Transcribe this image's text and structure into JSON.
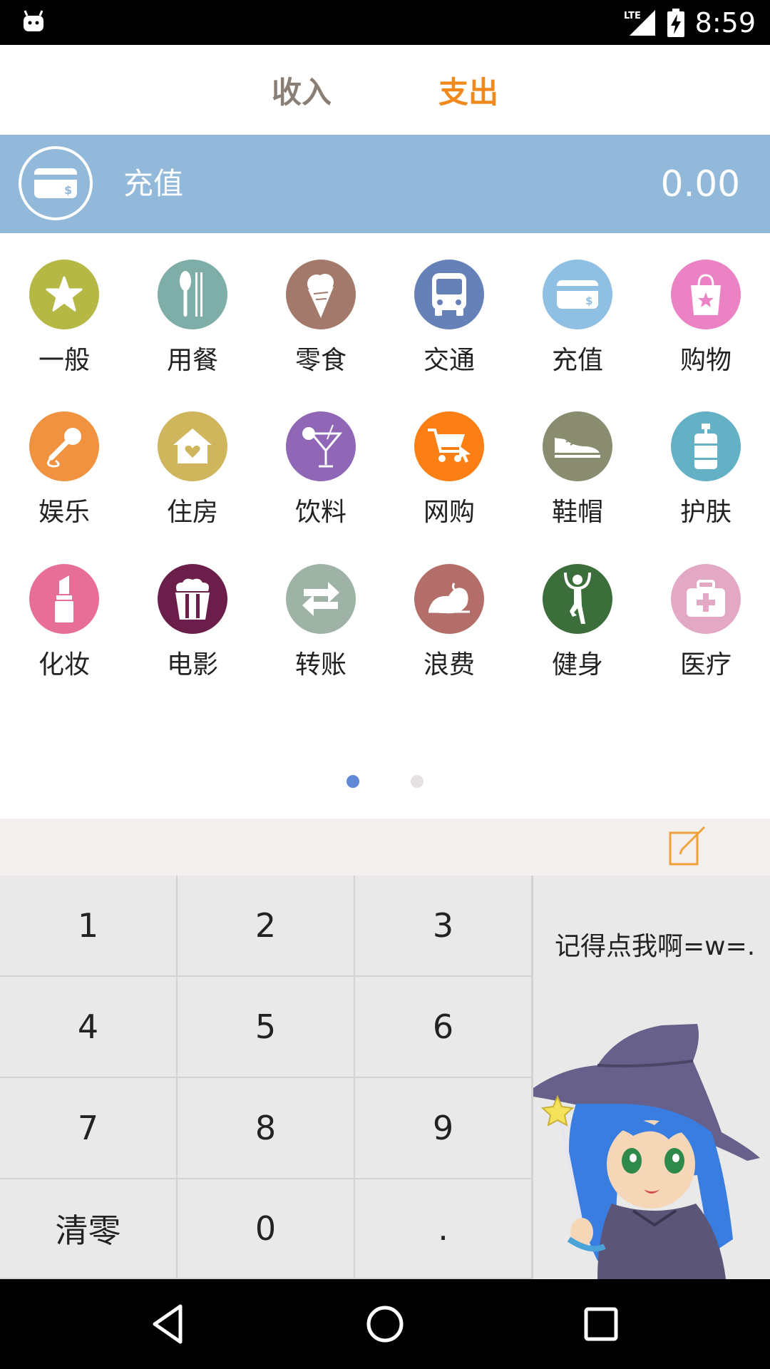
{
  "status_bar": {
    "network": "LTE",
    "time": "8:59"
  },
  "tabs": [
    {
      "label": "收入",
      "active": false
    },
    {
      "label": "支出",
      "active": true
    }
  ],
  "selected_category": {
    "label": "充值",
    "amount": "0.00",
    "icon": "card-icon",
    "color": "#92b8da"
  },
  "categories": [
    {
      "label": "一般",
      "icon": "star-icon",
      "color": "#b5b844"
    },
    {
      "label": "用餐",
      "icon": "spoon-fork-icon",
      "color": "#7fada7"
    },
    {
      "label": "零食",
      "icon": "ice-cream-icon",
      "color": "#a2796a"
    },
    {
      "label": "交通",
      "icon": "bus-icon",
      "color": "#6681b8"
    },
    {
      "label": "充值",
      "icon": "card-icon",
      "color": "#8fbfe2"
    },
    {
      "label": "购物",
      "icon": "shopping-bag-icon",
      "color": "#eb82c4"
    },
    {
      "label": "娱乐",
      "icon": "microphone-icon",
      "color": "#f0923f"
    },
    {
      "label": "住房",
      "icon": "house-icon",
      "color": "#cfb55c"
    },
    {
      "label": "饮料",
      "icon": "cocktail-icon",
      "color": "#9067b6"
    },
    {
      "label": "网购",
      "icon": "cart-icon",
      "color": "#fb7f14"
    },
    {
      "label": "鞋帽",
      "icon": "shoe-icon",
      "color": "#8a8c6f"
    },
    {
      "label": "护肤",
      "icon": "bottle-icon",
      "color": "#64b1c6"
    },
    {
      "label": "化妆",
      "icon": "lipstick-icon",
      "color": "#e76e96"
    },
    {
      "label": "电影",
      "icon": "popcorn-icon",
      "color": "#6c1e4a"
    },
    {
      "label": "转账",
      "icon": "transfer-icon",
      "color": "#9eb3a5"
    },
    {
      "label": "浪费",
      "icon": "chicken-icon",
      "color": "#b46e6a"
    },
    {
      "label": "健身",
      "icon": "fitness-icon",
      "color": "#3c6e3b"
    },
    {
      "label": "医疗",
      "icon": "medical-kit-icon",
      "color": "#e3a8c4"
    }
  ],
  "page_indicator": {
    "total": 2,
    "current": 1,
    "active_color": "#5f88d8",
    "inactive_color": "#e6e2e4"
  },
  "note": {
    "icon": "edit-note-icon",
    "color": "#f0a23a"
  },
  "keypad": {
    "keys": [
      "1",
      "2",
      "3",
      "4",
      "5",
      "6",
      "7",
      "8",
      "9",
      "清零",
      "0",
      "."
    ],
    "side_hint": "记得点我啊=w=.",
    "mascot": "witch-girl-mascot"
  },
  "nav_bar": {
    "back": "back-icon",
    "home": "home-icon",
    "recents": "recents-icon"
  }
}
